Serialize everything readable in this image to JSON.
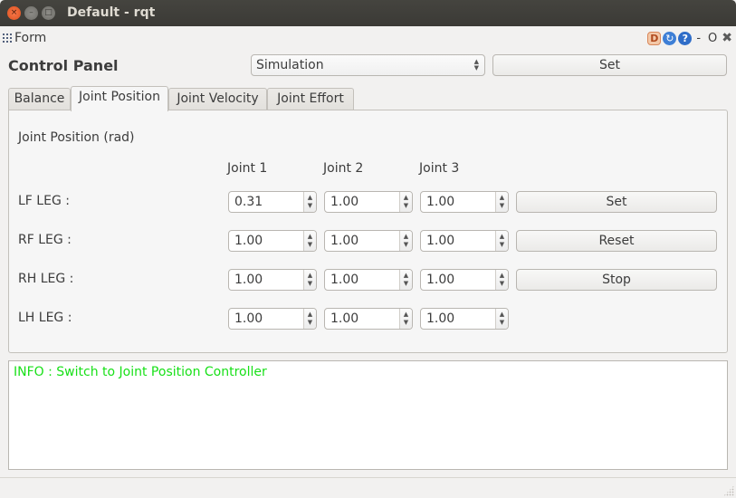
{
  "window": {
    "title": "Default - rqt",
    "close_glyph": "×",
    "min_glyph": "–",
    "max_glyph": "□"
  },
  "menubar": {
    "plugin_label": "Form",
    "icons": {
      "d_label": "D",
      "refresh_glyph": "↻",
      "help_glyph": "?",
      "dash": "-",
      "o": "O",
      "close_glyph": "✖"
    }
  },
  "header": {
    "title": "Control Panel",
    "mode_select": {
      "value": "Simulation"
    },
    "set_label": "Set"
  },
  "tabs": [
    {
      "label": "Balance",
      "active": false
    },
    {
      "label": "Joint Position",
      "active": true
    },
    {
      "label": "Joint Velocity",
      "active": false
    },
    {
      "label": "Joint Effort",
      "active": false
    }
  ],
  "panel": {
    "heading": "Joint Position (rad)",
    "columns": [
      "Joint 1",
      "Joint 2",
      "Joint 3"
    ],
    "rows": [
      {
        "label": "LF LEG :",
        "values": [
          "0.31",
          "1.00",
          "1.00"
        ]
      },
      {
        "label": "RF LEG :",
        "values": [
          "1.00",
          "1.00",
          "1.00"
        ]
      },
      {
        "label": "RH LEG :",
        "values": [
          "1.00",
          "1.00",
          "1.00"
        ]
      },
      {
        "label": "LH LEG :",
        "values": [
          "1.00",
          "1.00",
          "1.00"
        ]
      }
    ],
    "buttons": {
      "set": "Set",
      "reset": "Reset",
      "stop": "Stop"
    }
  },
  "log": {
    "lines": [
      "INFO : Switch to Joint Position Controller"
    ],
    "info_color": "#18e018"
  },
  "spin_arrows": {
    "up": "▲",
    "down": "▼"
  }
}
